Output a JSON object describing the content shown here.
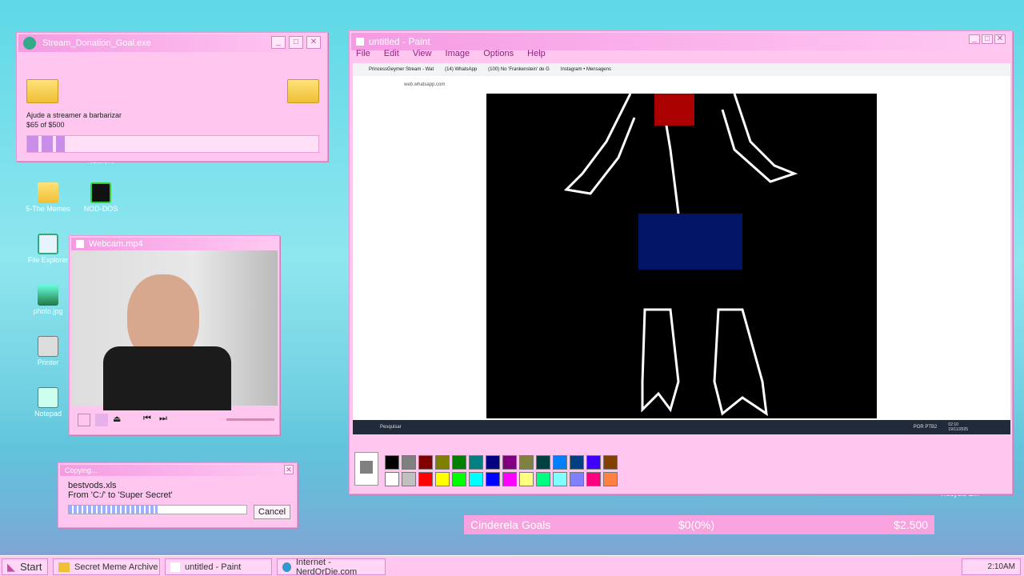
{
  "desktop": {
    "icons": [
      {
        "label": "Network",
        "ico": "network-icon"
      },
      {
        "label": "5-The Memes",
        "ico": "folder-icon"
      },
      {
        "label": "NOD-DOS",
        "ico": "nod-icon"
      },
      {
        "label": "File Explorer",
        "ico": "magnifier-icon"
      },
      {
        "label": "photo.jpg",
        "ico": "image-icon"
      },
      {
        "label": "Printer",
        "ico": "printer-icon"
      },
      {
        "label": "Notepad",
        "ico": "notepad-icon"
      },
      {
        "label": "Recycle Bin",
        "ico": "recycle-bin-icon"
      }
    ]
  },
  "donation": {
    "title": "Stream_Donation_Goal.exe",
    "text": "Ajude a streamer a barbarizar",
    "amount": "$65 of $500",
    "progress": 0.13
  },
  "webcam": {
    "title": "Webcam.mp4"
  },
  "copying": {
    "title": "Copying...",
    "file": "bestvods.xls",
    "path": "From 'C:/' to 'Super Secret'",
    "cancel": "Cancel",
    "progress": 0.5
  },
  "paint": {
    "title": "untitled - Paint",
    "menu": [
      "File",
      "Edit",
      "View",
      "Image",
      "Options",
      "Help"
    ],
    "browser": {
      "tabs": [
        "PrincessGeymer Stream - Wat",
        "(14) WhatsApp",
        "(100) No 'Frankenstein' de G",
        "Instagram • Mensagens"
      ],
      "url": "web.whatsapp.com"
    },
    "winsearch": "Pesquisar",
    "tray": "POR PTB2",
    "clock": "02:10\n19/11/2025",
    "palette": [
      "#000000",
      "#808080",
      "#800000",
      "#808000",
      "#008000",
      "#008080",
      "#000080",
      "#800080",
      "#808040",
      "#004040",
      "#0080ff",
      "#004080",
      "#4000ff",
      "#804000",
      "#ffffff",
      "#c0c0c0",
      "#ff0000",
      "#ffff00",
      "#00ff00",
      "#00ffff",
      "#0000ff",
      "#ff00ff",
      "#ffff80",
      "#00ff80",
      "#80ffff",
      "#8080ff",
      "#ff0080",
      "#ff8040"
    ]
  },
  "goals": {
    "name": "Cinderela Goals",
    "current": "$0(0%)",
    "target": "$2.500"
  },
  "taskbar": {
    "start": "Start",
    "items": [
      "Secret Meme Archive",
      "untitled - Paint",
      "Internet - NerdOrDie.com"
    ],
    "time": "2:10AM"
  }
}
